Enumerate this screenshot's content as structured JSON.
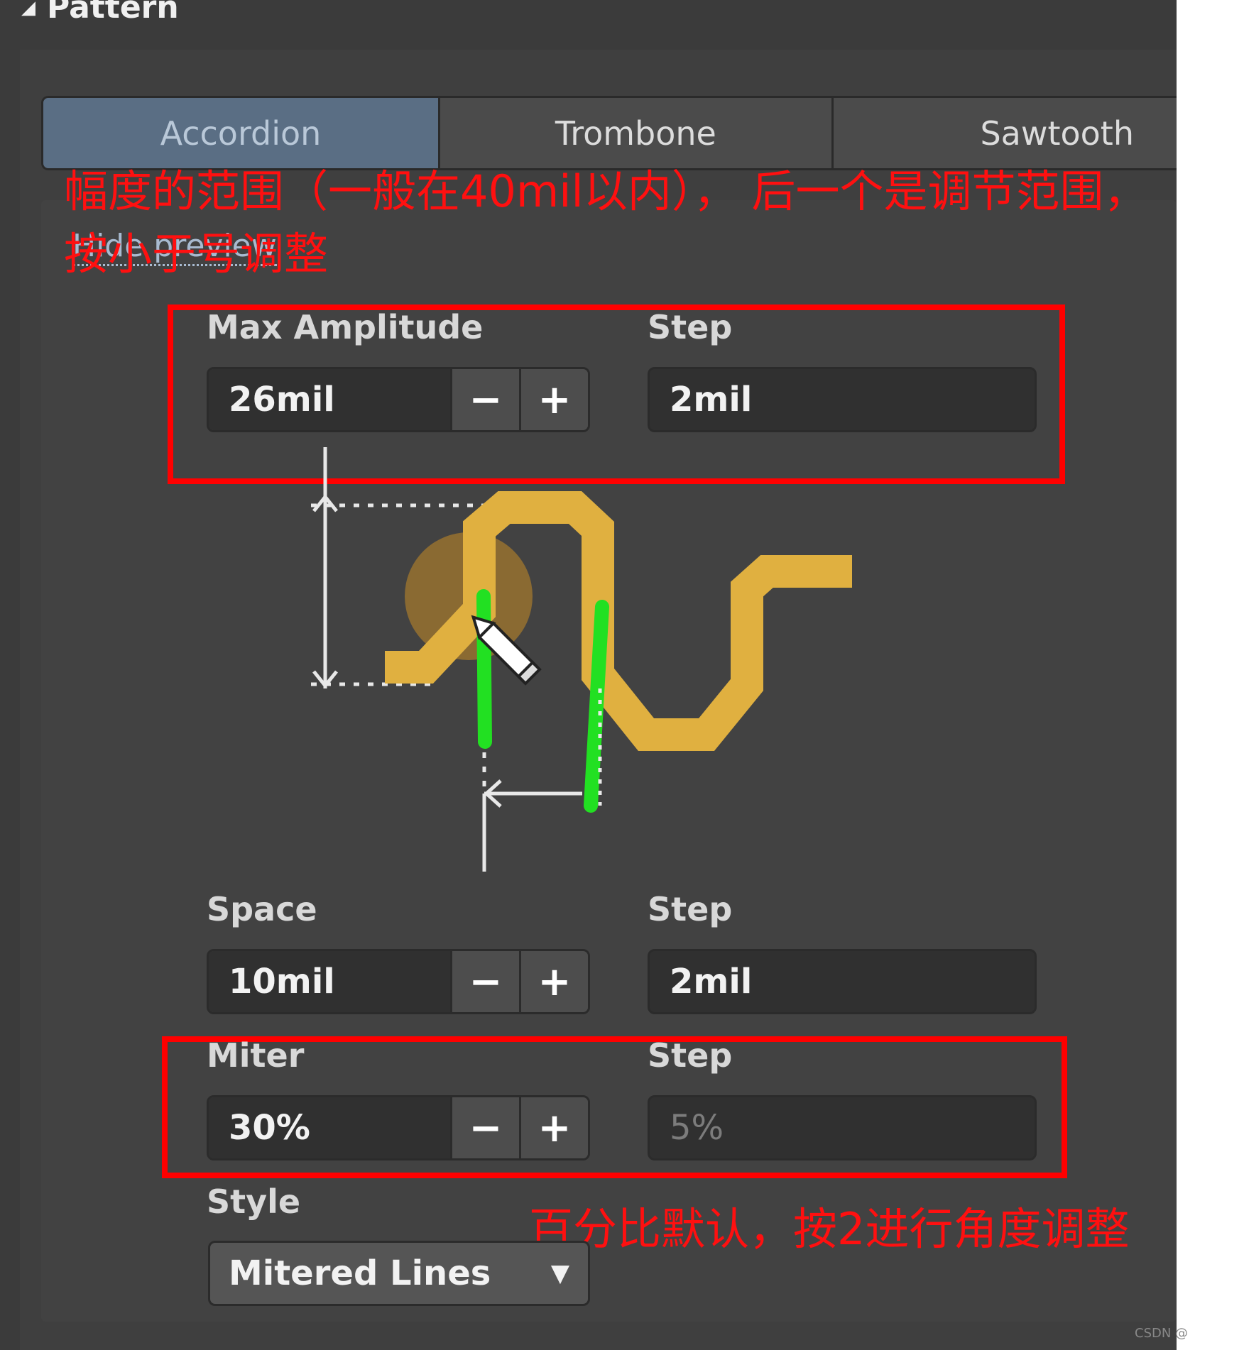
{
  "section_title": "Pattern",
  "tabs": [
    {
      "label": "Accordion",
      "active": true
    },
    {
      "label": "Trombone",
      "active": false
    },
    {
      "label": "Sawtooth",
      "active": false
    }
  ],
  "hide_preview_link": "Hide preview",
  "annotations": {
    "top_line1": "幅度的范围（一般在40mil以内）， 后一个是调节范围，",
    "top_line2": "按小于号调整",
    "bottom": "百分比默认，按2进行角度调整"
  },
  "fields": {
    "max_amplitude": {
      "label": "Max Amplitude",
      "value": "26mil",
      "step_label": "Step",
      "step_value": "2mil"
    },
    "space": {
      "label": "Space",
      "value": "10mil",
      "step_label": "Step",
      "step_value": "2mil"
    },
    "miter": {
      "label": "Miter",
      "value": "30%",
      "step_label": "Step",
      "step_value": "5%"
    }
  },
  "style": {
    "label": "Style",
    "value": "Mitered Lines"
  },
  "buttons": {
    "minus": "−",
    "plus": "+"
  },
  "watermark": "CSDN @",
  "colors": {
    "panel_bg": "#3b3b3b",
    "tab_active": "#5a6e84",
    "trace": "#e0b040",
    "highlight_green": "#22e022",
    "annotation_red": "#ff1010"
  }
}
